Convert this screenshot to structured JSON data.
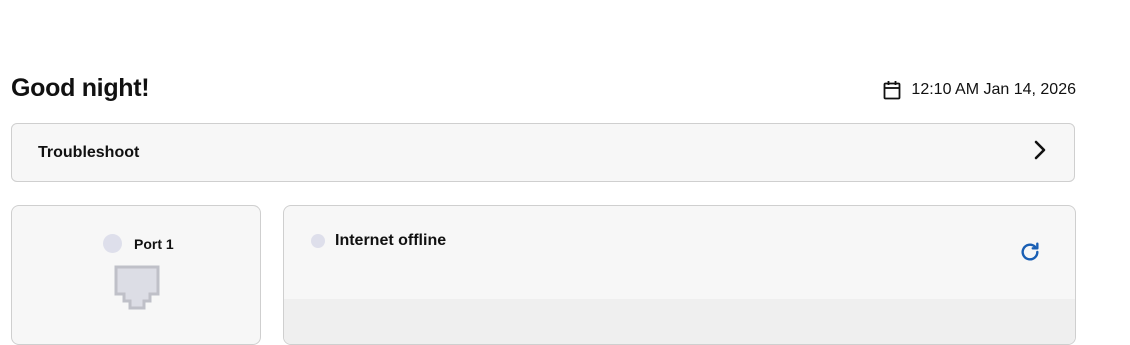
{
  "header": {
    "greeting": "Good night!",
    "datetime": "12:10 AM Jan 14, 2026",
    "calendar_icon": "calendar-icon"
  },
  "troubleshoot": {
    "label": "Troubleshoot",
    "icon": "chevron-right-icon"
  },
  "port": {
    "label": "Port 1",
    "status_color": "#dedfeb",
    "icon": "ethernet-port-icon"
  },
  "internet": {
    "status": "Internet offline",
    "status_color": "#dedfeb",
    "refresh_icon": "refresh-icon",
    "accent": "#1a5fb4"
  }
}
